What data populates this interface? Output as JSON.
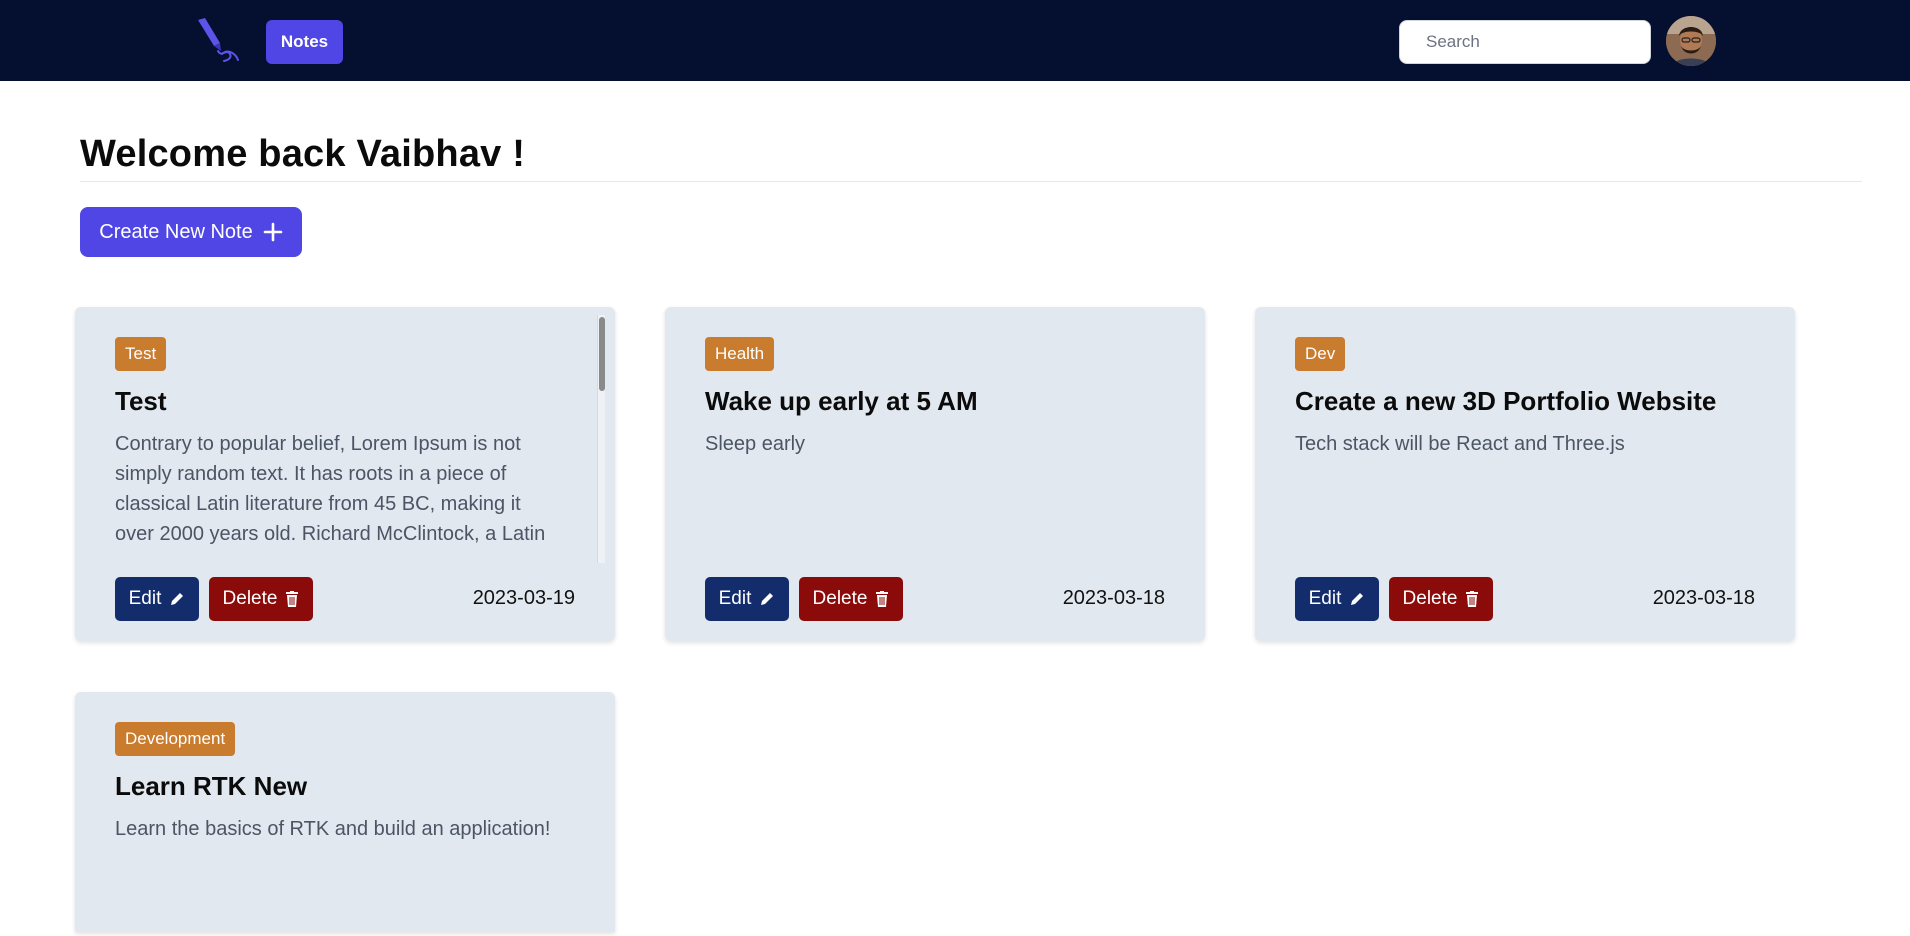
{
  "navbar": {
    "logo_icon": "pen-logo-icon",
    "notes_label": "Notes",
    "search_placeholder": "Search",
    "avatar_icon": "user-avatar"
  },
  "main": {
    "welcome": "Welcome back Vaibhav !",
    "create_label": "Create New Note",
    "create_icon": "plus-icon"
  },
  "colors": {
    "navbar": "#050f2f",
    "primary": "#4f46e5",
    "card": "#e2e8f0",
    "tag": "#c97b2e",
    "edit": "#132d6c",
    "delete": "#8b0a0a"
  },
  "notes": [
    {
      "tag": "Test",
      "title": "Test",
      "body": "Contrary to popular belief, Lorem Ipsum is not simply random text. It has roots in a piece of classical Latin literature from 45 BC, making it over 2000 years old. Richard McClintock, a Latin professor at Hampden-Sydney College in Virginia,",
      "edit_label": "Edit",
      "delete_label": "Delete",
      "date": "2023-03-19"
    },
    {
      "tag": "Health",
      "title": "Wake up early at 5 AM",
      "body": "Sleep early",
      "edit_label": "Edit",
      "delete_label": "Delete",
      "date": "2023-03-18"
    },
    {
      "tag": "Dev",
      "title": "Create a new 3D Portfolio Website",
      "body": "Tech stack will be React and Three.js",
      "edit_label": "Edit",
      "delete_label": "Delete",
      "date": "2023-03-18"
    },
    {
      "tag": "Development",
      "title": "Learn RTK New",
      "body": "Learn the basics of RTK and build an application!"
    }
  ]
}
